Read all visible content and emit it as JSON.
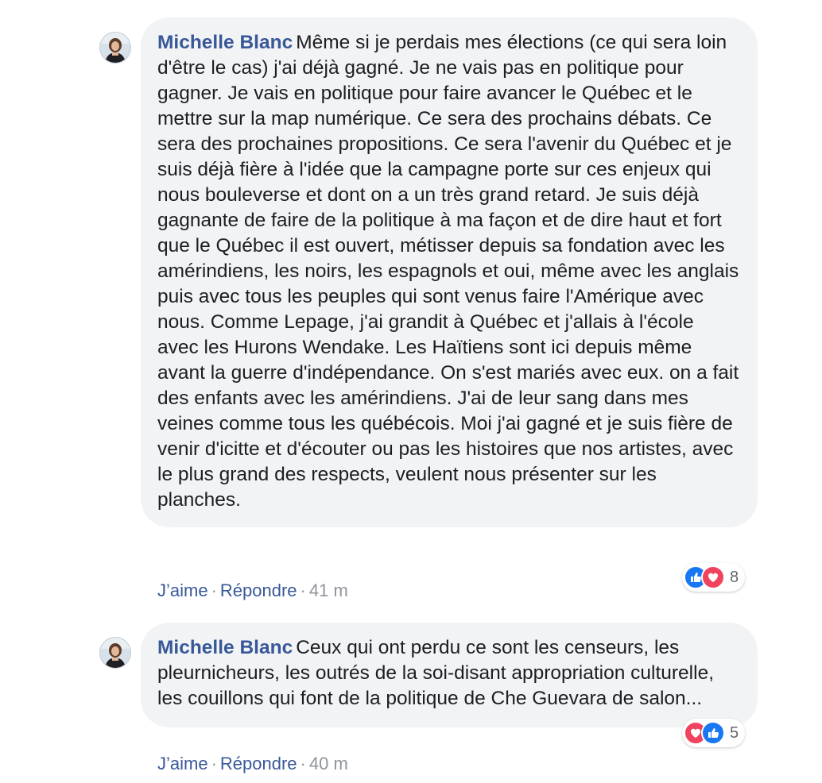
{
  "colors": {
    "author": "#385898",
    "bubble_background": "#f2f3f5",
    "like_blue": "#1877f2",
    "love_red": "#f0435e",
    "meta_gray": "#90949c"
  },
  "comments": [
    {
      "author": "Michelle Blanc",
      "text": "Même si je perdais mes élections (ce qui sera loin d'être le cas) j'ai déjà gagné. Je ne vais pas en politique pour gagner. Je vais en politique pour faire avancer le Québec et le mettre sur la map numérique. Ce sera des prochains débats. Ce sera des prochaines propositions. Ce sera l'avenir du Québec et je suis déjà fière à l'idée que la campagne porte sur ces enjeux qui nous bouleverse et dont on a un très grand retard. Je suis déjà gagnante de faire de la politique à ma façon et de dire haut et fort que le Québec il est ouvert, métisser depuis sa fondation avec les amérindiens, les noirs, les espagnols et oui, même avec les anglais puis avec tous les peuples qui sont venus faire l'Amérique avec nous. Comme Lepage, j'ai grandit à Québec et j'allais à l'école avec les Hurons Wendake. Les Haïtiens sont ici depuis même avant la guerre d'indépendance. On s'est mariés avec eux. on a fait des enfants avec les amérindiens. J'ai de leur sang dans mes veines comme tous les québécois. Moi j'ai gagné et je suis fière de venir d'icitte et d'écouter ou pas les histoires que nos artistes, avec le plus grand des respects, veulent nous présenter sur les planches.",
      "like_label": "J’aime",
      "reply_label": "Répondre",
      "separator": "·",
      "time": "41 m",
      "reactions": [
        "like-icon",
        "love-icon"
      ],
      "reaction_count": "8"
    },
    {
      "author": "Michelle Blanc",
      "text": "Ceux qui ont perdu ce sont les censeurs, les pleurnicheurs, les outrés de la soi-disant appropriation culturelle, les couillons qui font de la politique de Che Guevara de salon...",
      "like_label": "J’aime",
      "reply_label": "Répondre",
      "separator": "·",
      "time": "40 m",
      "reactions": [
        "love-icon",
        "like-icon"
      ],
      "reaction_count": "5"
    }
  ]
}
